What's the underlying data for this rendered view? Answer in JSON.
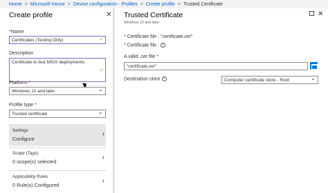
{
  "breadcrumb": {
    "items": [
      "Home",
      "Microsoft Intune",
      "Device configuration - Profiles",
      "Create profile",
      "Trusted Certificate"
    ]
  },
  "left_blade": {
    "title": "Create profile",
    "name_label": "Name",
    "name_value": "Certificates (Testing Only)",
    "description_label": "Description",
    "description_value": "Certificate to test MSIX deployments",
    "platform_label": "Platform",
    "platform_value": "Windows 10 and later",
    "profile_type_label": "Profile type",
    "profile_type_value": "Trusted certificate",
    "settings": {
      "title": "Settings",
      "subtitle": "Configure"
    },
    "scope": {
      "title": "Scope (Tags)",
      "subtitle": "0 scope(s) selected"
    },
    "applicability": {
      "title": "Applicability Rules",
      "subtitle": "0 Rule(s) Configured"
    }
  },
  "right_blade": {
    "title": "Trusted Certificate",
    "subtitle": "Windows 10 and later",
    "cert_file_line": "Certificate file : \"certificate.cer\"",
    "cert_file_label": "Certificate file :",
    "valid_cer_label": "A valid .cer file",
    "file_value": "\"certificate.cer\"",
    "destination_label": "Destination store",
    "destination_value": "Computer certificate store - Root"
  },
  "symbols": {
    "required": "*",
    "check": "✓",
    "close": "✕",
    "chevron_right": "›",
    "chevron_down": "⌄",
    "separator": ">"
  },
  "colors": {
    "link": "#0064c8",
    "accent_focus": "#8764b8",
    "valid": "#57a300",
    "required": "#a4262c",
    "primary": "#0078d4"
  }
}
